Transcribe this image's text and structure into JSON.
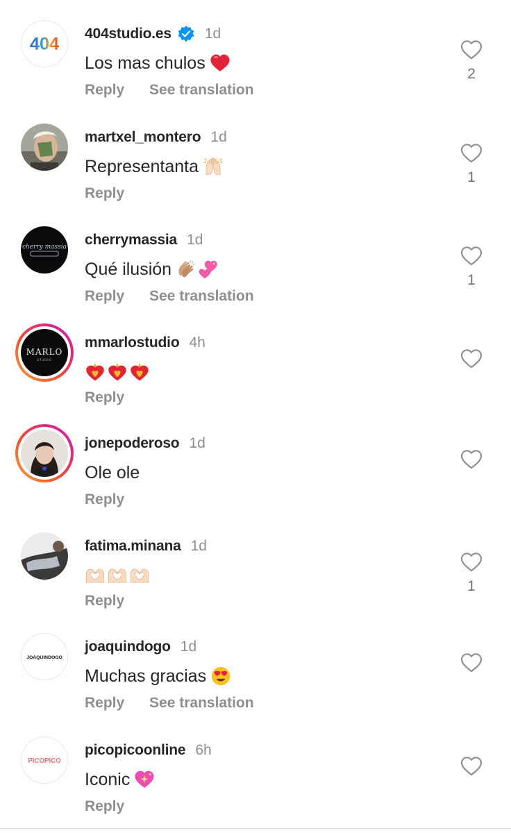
{
  "comments": [
    {
      "username": "404studio.es",
      "verified": true,
      "time": "1d",
      "text": "Los mas chulos",
      "emoji": [
        "red-heart-emoji"
      ],
      "reply_label": "Reply",
      "translation_label": "See translation",
      "likes": "2",
      "avatar": "404-logo"
    },
    {
      "username": "martxel_montero",
      "verified": false,
      "time": "1d",
      "text": "Representanta",
      "emoji": [
        "raising-hands-emoji"
      ],
      "reply_label": "Reply",
      "likes": "1",
      "avatar": "profile-photo"
    },
    {
      "username": "cherrymassia",
      "verified": false,
      "time": "1d",
      "text": "Qué ilusión",
      "emoji": [
        "clapping-hands-emoji",
        "two-hearts-emoji"
      ],
      "reply_label": "Reply",
      "translation_label": "See translation",
      "likes": "1",
      "avatar": "cherry-massia-logo"
    },
    {
      "username": "mmarlostudio",
      "verified": false,
      "time": "4h",
      "text": "",
      "emoji": [
        "heart-on-fire-emoji",
        "heart-on-fire-emoji",
        "heart-on-fire-emoji"
      ],
      "reply_label": "Reply",
      "likes": "",
      "avatar": "marlo-studio-logo"
    },
    {
      "username": "jonepoderoso",
      "verified": false,
      "time": "1d",
      "text": "Ole ole",
      "emoji": [],
      "reply_label": "Reply",
      "likes": "",
      "avatar": "profile-photo"
    },
    {
      "username": "fatima.minana",
      "verified": false,
      "time": "1d",
      "text": "",
      "emoji": [
        "heart-hands-emoji",
        "heart-hands-emoji",
        "heart-hands-emoji"
      ],
      "reply_label": "Reply",
      "likes": "1",
      "avatar": "profile-photo"
    },
    {
      "username": "joaquindogo",
      "verified": false,
      "time": "1d",
      "text": "Muchas gracias",
      "emoji": [
        "heart-eyes-emoji"
      ],
      "reply_label": "Reply",
      "translation_label": "See translation",
      "likes": "",
      "avatar": "joaquindogo-logo",
      "avatar_text": "JOAQUINDOGO"
    },
    {
      "username": "picopicoonline",
      "verified": false,
      "time": "6h",
      "text": "Iconic",
      "emoji": [
        "sparkling-heart-emoji"
      ],
      "reply_label": "Reply",
      "likes": "",
      "avatar": "picopico-logo",
      "avatar_text": "PICOPICO"
    }
  ],
  "colors": {
    "text": "#262626",
    "secondary": "#8e8e8e",
    "verified": "#0095f6",
    "story_ring_start": "#f9a33a",
    "story_ring_end": "#b92fb8"
  },
  "avatar_logo_text": {
    "studio404": "404",
    "cherry": "cherry massia",
    "marlo": "MARLO",
    "marlo_sub": "STUDIO"
  }
}
